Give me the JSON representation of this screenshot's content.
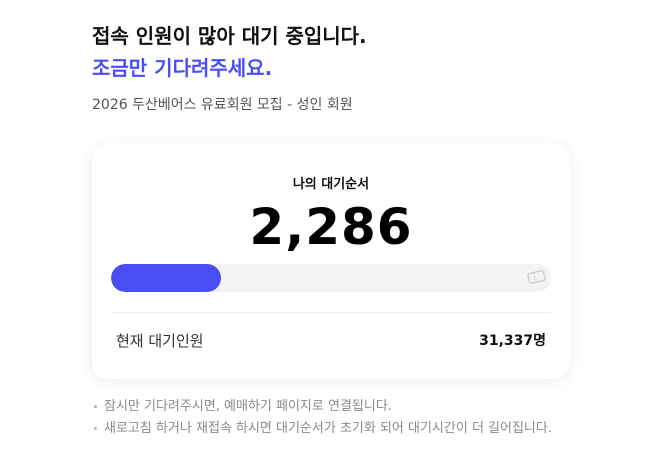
{
  "header": {
    "headline": "접속 인원이 많아 대기 중입니다.",
    "headline_accent": "조금만 기다려주세요.",
    "subtitle": "2026 두산베어스 유료회원 모집 - 성인 회원"
  },
  "queue_card": {
    "label": "나의 대기순서",
    "position": "2,286",
    "progress_percent": 25,
    "ticket_icon": "ticket-icon",
    "total_label": "현재 대기인원",
    "total_value": "31,337명"
  },
  "notes": [
    "잠시만 기다려주시면, 예매하기 페이지로 연결됩니다.",
    "새로고침 하거나 재접속 하시면 대기순서가 초기화 되어 대기시간이 더 길어집니다."
  ],
  "colors": {
    "accent": "#4a4ff5",
    "track": "#f3f3f5",
    "note_text": "#8a8a8a"
  }
}
